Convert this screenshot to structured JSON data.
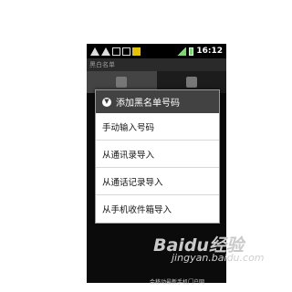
{
  "status_bar": {
    "time": "16:12",
    "icons": [
      "warning-icon",
      "alert-icon",
      "usb-icon",
      "wifi-icon",
      "app-icon",
      "signal-icon",
      "battery-icon"
    ]
  },
  "app": {
    "title": "黑白名单"
  },
  "dialog": {
    "title": "添加黑名单号码",
    "options": [
      "手动输入号码",
      "从通讯录导入",
      "从通话记录导入",
      "从手机收件箱导入"
    ]
  },
  "watermark": {
    "brand": "Baidu经验",
    "url": "jingyan.baidu.com",
    "caption": "会移动最新手机门户网"
  }
}
